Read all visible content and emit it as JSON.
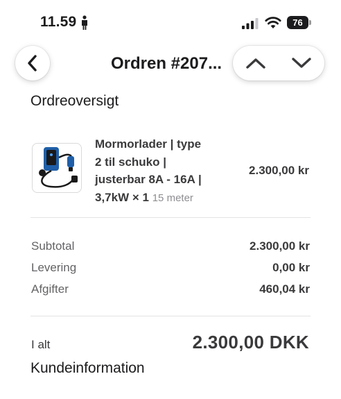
{
  "status_bar": {
    "time": "11.59",
    "battery": "76",
    "icons": [
      "person-icon",
      "signal-icon",
      "wifi-icon",
      "battery-icon"
    ]
  },
  "nav": {
    "title": "Ordren #207...",
    "back_icon": "chevron-left-icon",
    "prev_icon": "chevron-up-icon",
    "next_icon": "chevron-down-icon"
  },
  "order_overview": {
    "title": "Ordreoversigt",
    "items": [
      {
        "name_lines": [
          "Mormorlader | type",
          "2 til schuko |",
          "justerbar 8A - 16A |"
        ],
        "name_last": "3,7kW",
        "quantity": "× 1",
        "variant": "15 meter",
        "price": "2.300,00 kr",
        "image": "ev-charger-cable-image"
      }
    ]
  },
  "summary": {
    "rows": [
      {
        "label": "Subtotal",
        "value": "2.300,00 kr"
      },
      {
        "label": "Levering",
        "value": "0,00 kr"
      },
      {
        "label": "Afgifter",
        "value": "460,04 kr"
      }
    ],
    "total_label": "I alt",
    "total_value": "2.300,00 DKK"
  },
  "customer_info": {
    "title": "Kundeinformation"
  },
  "colors": {
    "text_primary": "#1c1c1e",
    "text_secondary": "#636366",
    "variant_gray": "#8e8e93",
    "charger_blue": "#1f5fa8"
  }
}
